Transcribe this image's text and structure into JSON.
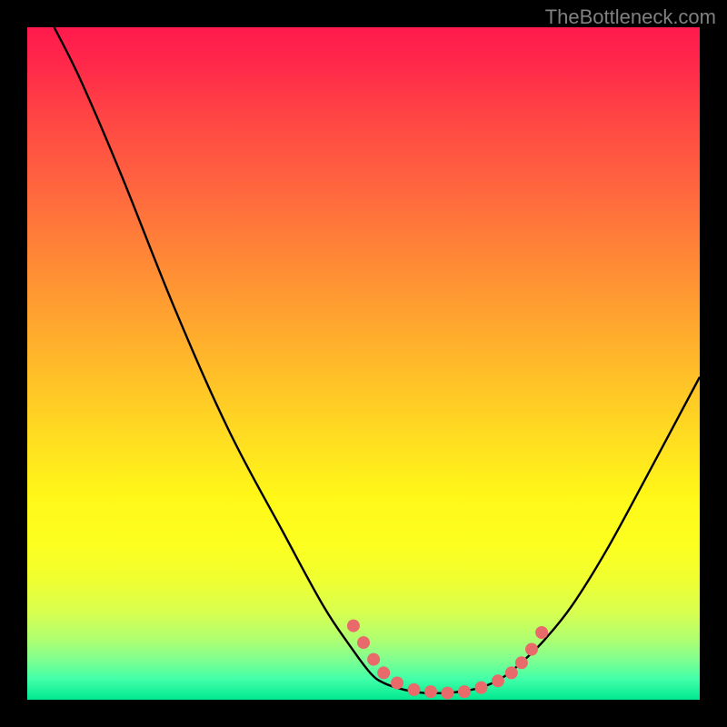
{
  "watermark": "TheBottleneck.com",
  "chart_data": {
    "type": "line",
    "title": "",
    "xlabel": "",
    "ylabel": "",
    "xlim": [
      0,
      100
    ],
    "ylim": [
      0,
      100
    ],
    "gradient_colors": {
      "top": "#ff1a4d",
      "mid_top": "#ffa030",
      "mid": "#fff818",
      "mid_bottom": "#b0ff70",
      "bottom": "#00e890"
    },
    "curve_points": [
      {
        "x": 4,
        "y": 100
      },
      {
        "x": 8,
        "y": 92
      },
      {
        "x": 14,
        "y": 78
      },
      {
        "x": 22,
        "y": 58
      },
      {
        "x": 30,
        "y": 40
      },
      {
        "x": 38,
        "y": 25
      },
      {
        "x": 44,
        "y": 14
      },
      {
        "x": 48,
        "y": 8
      },
      {
        "x": 51,
        "y": 4
      },
      {
        "x": 53,
        "y": 2.5
      },
      {
        "x": 56,
        "y": 1.5
      },
      {
        "x": 59,
        "y": 1
      },
      {
        "x": 62,
        "y": 1
      },
      {
        "x": 65,
        "y": 1.3
      },
      {
        "x": 68,
        "y": 2
      },
      {
        "x": 71,
        "y": 3.5
      },
      {
        "x": 74,
        "y": 6
      },
      {
        "x": 77,
        "y": 9
      },
      {
        "x": 81,
        "y": 14
      },
      {
        "x": 86,
        "y": 22
      },
      {
        "x": 92,
        "y": 33
      },
      {
        "x": 100,
        "y": 48
      }
    ],
    "marker_points": [
      {
        "x": 48.5,
        "y": 11
      },
      {
        "x": 50,
        "y": 8.5
      },
      {
        "x": 51.5,
        "y": 6
      },
      {
        "x": 53,
        "y": 4
      },
      {
        "x": 55,
        "y": 2.5
      },
      {
        "x": 57.5,
        "y": 1.5
      },
      {
        "x": 60,
        "y": 1.2
      },
      {
        "x": 62.5,
        "y": 1
      },
      {
        "x": 65,
        "y": 1.2
      },
      {
        "x": 67.5,
        "y": 1.8
      },
      {
        "x": 70,
        "y": 2.8
      },
      {
        "x": 72,
        "y": 4
      },
      {
        "x": 73.5,
        "y": 5.5
      },
      {
        "x": 75,
        "y": 7.5
      },
      {
        "x": 76.5,
        "y": 10
      }
    ],
    "marker_color": "#e86a6a",
    "curve_color": "#000000"
  }
}
